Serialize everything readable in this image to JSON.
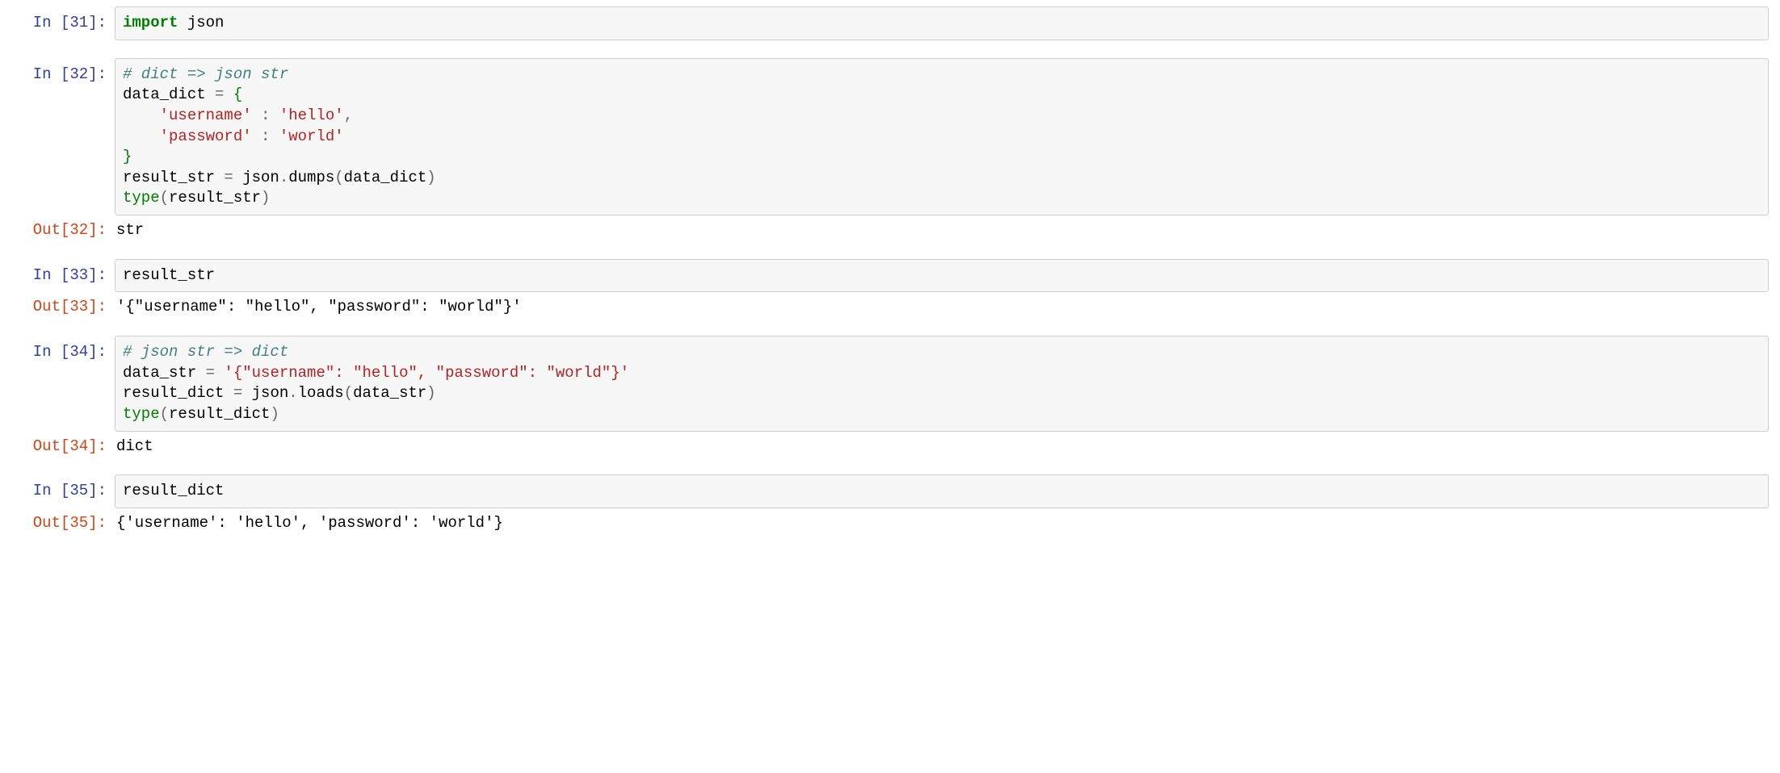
{
  "cells": [
    {
      "prompt_in": "In [31]:",
      "code_html": "<span class=\"keyword\">import</span> json"
    },
    {
      "prompt_in": "In [32]:",
      "code_html": "<span class=\"comment\"># dict =&gt; json str</span>\ndata_dict <span class=\"op\">=</span> <span class=\"brace\">{</span>\n    <span class=\"string\">'username'</span> <span class=\"punct\">:</span> <span class=\"string\">'hello'</span><span class=\"punct\">,</span>\n    <span class=\"string\">'password'</span> <span class=\"punct\">:</span> <span class=\"string\">'world'</span>\n<span class=\"brace\">}</span>\nresult_str <span class=\"op\">=</span> json<span class=\"op\">.</span>dumps<span class=\"punct\">(</span>data_dict<span class=\"punct\">)</span>\n<span class=\"builtin\">type</span><span class=\"punct\">(</span>result_str<span class=\"punct\">)</span>",
      "prompt_out": "Out[32]:",
      "output": "str"
    },
    {
      "prompt_in": "In [33]:",
      "code_html": "result_str",
      "prompt_out": "Out[33]:",
      "output": "'{\"username\": \"hello\", \"password\": \"world\"}'"
    },
    {
      "prompt_in": "In [34]:",
      "code_html": "<span class=\"comment\"># json str =&gt; dict</span>\ndata_str <span class=\"op\">=</span> <span class=\"string\">'{\"username\": \"hello\", \"password\": \"world\"}'</span>\nresult_dict <span class=\"op\">=</span> json<span class=\"op\">.</span>loads<span class=\"punct\">(</span>data_str<span class=\"punct\">)</span>\n<span class=\"builtin\">type</span><span class=\"punct\">(</span>result_dict<span class=\"punct\">)</span>",
      "prompt_out": "Out[34]:",
      "output": "dict"
    },
    {
      "prompt_in": "In [35]:",
      "code_html": "result_dict",
      "prompt_out": "Out[35]:",
      "output": "{'username': 'hello', 'password': 'world'}"
    }
  ]
}
